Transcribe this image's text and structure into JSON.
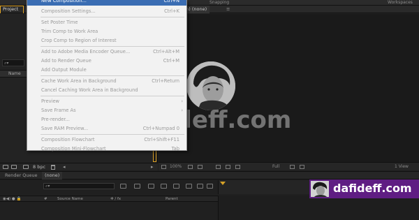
{
  "topbar": {
    "left_menu_text": "New Composition",
    "left_menu_shortcut": "Ctrl+N",
    "snapping_label": "Snapping",
    "workspaces_label": "Workspaces"
  },
  "project_panel": {
    "tab_label": "Project",
    "search_icon": "⌕▾",
    "column_name": "Name",
    "bpc_label": "8 bpc"
  },
  "comp_panel": {
    "tab_label": "ition) (none)",
    "close_glyph": "≡",
    "toolbar": {
      "zoom": "100%",
      "resolution": "Full",
      "views": "1 View"
    }
  },
  "menu": {
    "highlighted": {
      "label": "New Composition...",
      "shortcut": "Ctrl+N"
    },
    "items": [
      {
        "label": "Composition Settings...",
        "shortcut": "Ctrl+K",
        "enabled": false
      },
      {
        "label": "Set Poster Time",
        "shortcut": "",
        "enabled": false
      },
      {
        "label": "Trim Comp to Work Area",
        "shortcut": "",
        "enabled": false
      },
      {
        "label": "Crop Comp to Region of Interest",
        "shortcut": "",
        "enabled": false
      },
      {
        "label": "Add to Adobe Media Encoder Queue...",
        "shortcut": "Ctrl+Alt+M",
        "enabled": false
      },
      {
        "label": "Add to Render Queue",
        "shortcut": "Ctrl+M",
        "enabled": false
      },
      {
        "label": "Add Output Module",
        "shortcut": "",
        "enabled": false
      },
      {
        "label": "Cache Work Area in Background",
        "shortcut": "Ctrl+Return",
        "enabled": false
      },
      {
        "label": "Cancel Caching Work Area in Background",
        "shortcut": "",
        "enabled": false
      },
      {
        "label": "Preview",
        "shortcut": "",
        "enabled": false,
        "submenu": true
      },
      {
        "label": "Save Frame As",
        "shortcut": "",
        "enabled": false,
        "submenu": true
      },
      {
        "label": "Pre-render...",
        "shortcut": "",
        "enabled": false
      },
      {
        "label": "Save RAM Preview...",
        "shortcut": "Ctrl+Numpad 0",
        "enabled": false
      },
      {
        "label": "Composition Flowchart",
        "shortcut": "Ctrl+Shift+F11",
        "enabled": false
      },
      {
        "label": "Composition Mini-Flowchart",
        "shortcut": "Tab",
        "enabled": false
      }
    ]
  },
  "timeline": {
    "tab_render_queue": "Render Queue",
    "tab_none": "(none)",
    "search_icon": "⌕▾",
    "col_hash": "#",
    "col_source_name": "Source Name",
    "col_switches": "✲ ∕ fx",
    "col_parent": "Parent"
  },
  "watermark": {
    "text": "dafideff.com"
  },
  "badge": {
    "text": "dafideff.com"
  },
  "colors": {
    "accent_orange": "#e0a324",
    "menu_bg": "#f2f2f2",
    "highlight_blue": "#3a6db3",
    "badge_purple": "#5f1d83"
  }
}
